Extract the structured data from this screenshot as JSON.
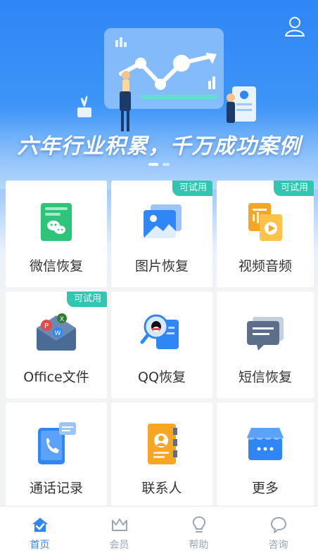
{
  "banner": {
    "slogan": "六年行业积累，千万成功案例",
    "slide_count": 2,
    "active_slide": 1
  },
  "features": [
    {
      "label": "微信恢复",
      "icon": "wechat-doc-icon",
      "badge": ""
    },
    {
      "label": "图片恢复",
      "icon": "picture-icon",
      "badge": "可试用"
    },
    {
      "label": "视频音频",
      "icon": "media-files-icon",
      "badge": "可试用"
    },
    {
      "label": "Office文件",
      "icon": "office-envelope-icon",
      "badge": "可试用"
    },
    {
      "label": "QQ恢复",
      "icon": "qq-icon",
      "badge": ""
    },
    {
      "label": "短信恢复",
      "icon": "sms-icon",
      "badge": ""
    },
    {
      "label": "通话记录",
      "icon": "phone-call-icon",
      "badge": ""
    },
    {
      "label": "联系人",
      "icon": "contacts-icon",
      "badge": ""
    },
    {
      "label": "更多",
      "icon": "store-more-icon",
      "badge": ""
    }
  ],
  "tabbar": [
    {
      "label": "首页",
      "icon": "home-icon",
      "active": true
    },
    {
      "label": "会员",
      "icon": "crown-icon",
      "active": false
    },
    {
      "label": "帮助",
      "icon": "lightbulb-icon",
      "active": false
    },
    {
      "label": "咨询",
      "icon": "chat-bubble-icon",
      "active": false
    }
  ],
  "colors": {
    "primary": "#2f86f6",
    "badge": "#32c6b2",
    "label": "#333333",
    "tab_inactive": "#9aa6b8"
  }
}
